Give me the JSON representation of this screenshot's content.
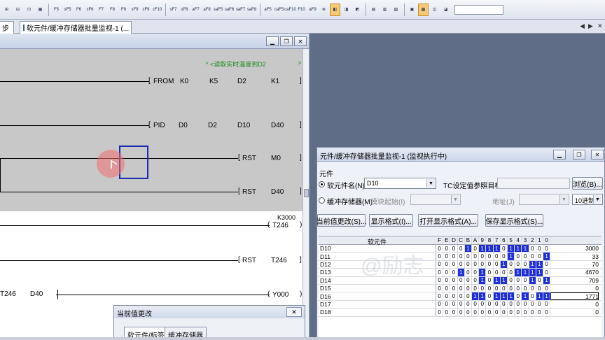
{
  "toolbar": {
    "groups": [
      [
        {
          "label": "⊞",
          "active": false
        },
        {
          "label": "⊟",
          "active": false
        },
        {
          "label": "⊡",
          "active": false
        },
        {
          "label": "▦",
          "active": false
        }
      ],
      [
        {
          "label": "F5",
          "active": false
        },
        {
          "label": "sF5",
          "active": false
        },
        {
          "label": "F6",
          "active": false
        },
        {
          "label": "sF6",
          "active": false
        },
        {
          "label": "F7",
          "active": false
        },
        {
          "label": "F8",
          "active": false
        },
        {
          "label": "F9",
          "active": false
        },
        {
          "label": "sF9",
          "active": false
        },
        {
          "label": "cF9",
          "active": false
        },
        {
          "label": "cF10",
          "active": false
        }
      ],
      [
        {
          "label": "sF7",
          "active": false
        },
        {
          "label": "sF8",
          "active": false
        },
        {
          "label": "aF7",
          "active": false
        },
        {
          "label": "aF8",
          "active": false
        },
        {
          "label": "saF5",
          "active": false
        },
        {
          "label": "saF6",
          "active": false
        },
        {
          "label": "saF7",
          "active": false
        },
        {
          "label": "saF8",
          "active": false
        }
      ],
      [
        {
          "label": "aF5",
          "active": false
        },
        {
          "label": "caF5",
          "active": false
        },
        {
          "label": "caF10",
          "active": false
        },
        {
          "label": "F10",
          "active": false
        },
        {
          "label": "aF9",
          "active": false
        },
        {
          "label": "⊗",
          "active": false
        },
        {
          "label": "◧",
          "active": true
        },
        {
          "label": "◨",
          "active": false
        },
        {
          "label": "◩",
          "active": false
        }
      ],
      [
        {
          "label": "▤",
          "active": false
        },
        {
          "label": "▥",
          "active": false
        },
        {
          "label": "▧",
          "active": false
        }
      ],
      [
        {
          "label": "▣",
          "active": false
        },
        {
          "label": "▩",
          "active": true
        },
        {
          "label": "◫",
          "active": false
        },
        {
          "label": "◪",
          "active": false
        }
      ]
    ]
  },
  "tabs": {
    "first_label": "步",
    "second_label": "软元件/缓冲存储器批量监视-1 (..."
  },
  "ladder": {
    "comment": "* <读取实时温度到D2",
    "comment_arrow": ">",
    "rows": [
      {
        "instr": "FROM",
        "ops": [
          "K0",
          "K5",
          "D2",
          "K1"
        ]
      },
      {
        "instr": "PID",
        "ops": [
          "D0",
          "D2",
          "D10",
          "D40"
        ]
      },
      {
        "instr": "RST",
        "ops": [
          "M0"
        ]
      },
      {
        "instr": "RST",
        "ops": [
          "D40"
        ]
      }
    ],
    "timer_const": "K3000",
    "timer_coil": "T246",
    "rst_t246_instr": "RST",
    "rst_t246_op": "T246",
    "contact1": "T246",
    "contact2": "D40",
    "coil_y": "Y000"
  },
  "monitor": {
    "title": "元件/缓冲存储器批量监视-1 (监视执行中)",
    "section_label": "元件",
    "device_radio_label": "软元件名(N)",
    "device_value": "D10",
    "tc_label": "TC设定值参照目标",
    "browse_label": "浏览(B)...",
    "buffer_radio_label": "缓冲存储器(M)",
    "module_start_label": "模块起始(I)",
    "addr_label": "地址(J)",
    "radix_value": "10进制",
    "buttons": [
      "当前值更改(S)...",
      "显示格式(I)...",
      "打开显示格式(A)...",
      "保存显示格式(S)..."
    ],
    "col_header": "软元件",
    "bit_headers": [
      "F",
      "E",
      "D",
      "C",
      "B",
      "A",
      "9",
      "8",
      "7",
      "6",
      "5",
      "4",
      "3",
      "2",
      "1",
      "0"
    ],
    "rows": [
      {
        "name": "D10",
        "bits": [
          0,
          0,
          0,
          0,
          1,
          0,
          1,
          1,
          1,
          0,
          1,
          1,
          1,
          0,
          0,
          0
        ],
        "value": "3000"
      },
      {
        "name": "D11",
        "bits": [
          0,
          0,
          0,
          0,
          0,
          0,
          0,
          0,
          0,
          0,
          1,
          0,
          0,
          0,
          0,
          1
        ],
        "value": "33"
      },
      {
        "name": "D12",
        "bits": [
          0,
          0,
          0,
          0,
          0,
          0,
          0,
          0,
          0,
          1,
          0,
          0,
          0,
          1,
          1,
          0
        ],
        "value": "70"
      },
      {
        "name": "D13",
        "bits": [
          0,
          0,
          0,
          1,
          0,
          0,
          1,
          0,
          0,
          0,
          0,
          1,
          1,
          1,
          1,
          0
        ],
        "value": "4670"
      },
      {
        "name": "D14",
        "bits": [
          0,
          0,
          0,
          0,
          0,
          0,
          1,
          0,
          1,
          1,
          0,
          0,
          0,
          1,
          0,
          1
        ],
        "value": "709"
      },
      {
        "name": "D15",
        "bits": [
          0,
          0,
          0,
          0,
          0,
          0,
          0,
          0,
          0,
          0,
          0,
          0,
          0,
          0,
          0,
          0
        ],
        "value": "0"
      },
      {
        "name": "D16",
        "bits": [
          0,
          0,
          0,
          0,
          0,
          1,
          1,
          0,
          1,
          1,
          1,
          0,
          1,
          0,
          1,
          1
        ],
        "value": "1771"
      },
      {
        "name": "D17",
        "bits": [
          0,
          0,
          0,
          0,
          0,
          0,
          0,
          0,
          0,
          0,
          0,
          0,
          0,
          0,
          0,
          0
        ],
        "value": "0"
      },
      {
        "name": "D18",
        "bits": [
          0,
          0,
          0,
          0,
          0,
          0,
          0,
          0,
          0,
          0,
          0,
          0,
          0,
          0,
          0,
          0
        ],
        "value": "0"
      }
    ],
    "watermark": "@励志"
  },
  "dialog": {
    "title": "当前值更改",
    "close_label": "✕",
    "tab1": "软元件/标签",
    "tab2": "缓冲存储器"
  },
  "colors": {
    "bit_on": "#1f2fd8",
    "comment": "#1c8a1c",
    "cursor": "#1a2bb0"
  }
}
